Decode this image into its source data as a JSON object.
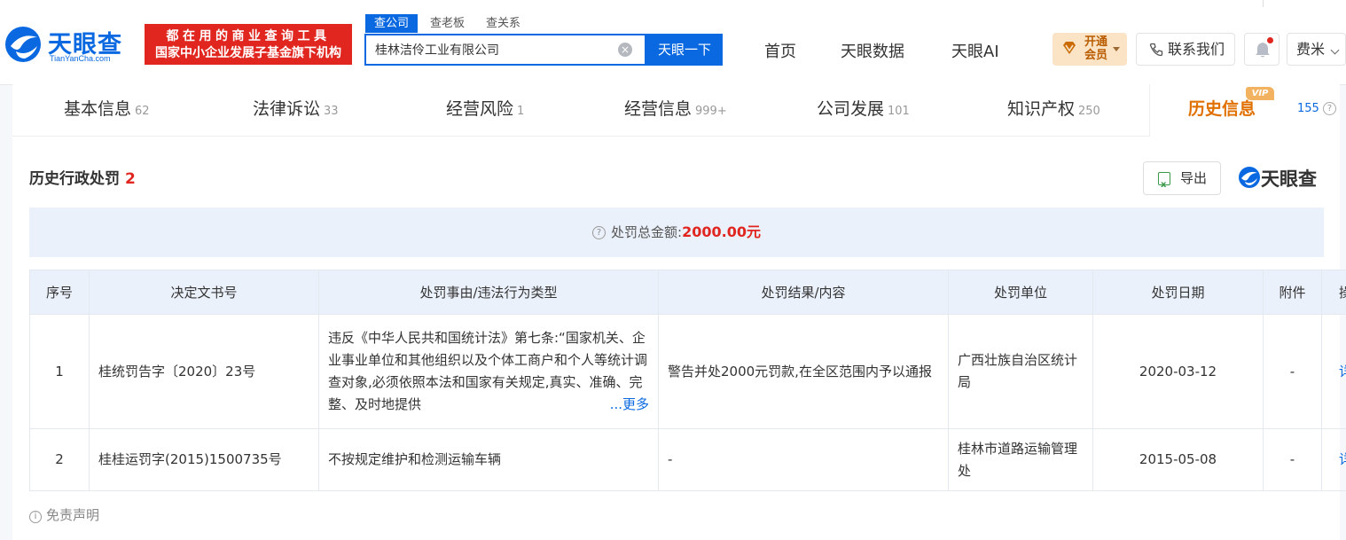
{
  "header": {
    "logo_text": "天眼查",
    "logo_sub": "TianYanCha.com",
    "promo_line1": "都在用的商业查询工具",
    "promo_line2": "国家中小企业发展子基金旗下机构",
    "search_tabs": [
      "查公司",
      "查老板",
      "查关系"
    ],
    "search_value": "桂林洁伶工业有限公司",
    "search_button": "天眼一下",
    "nav": [
      "首页",
      "天眼数据",
      "天眼AI"
    ],
    "vip_label": "开通会员",
    "contact_label": "联系我们",
    "user_name": "费米"
  },
  "tabs": [
    {
      "label": "基本信息",
      "count": "62"
    },
    {
      "label": "法律诉讼",
      "count": "33"
    },
    {
      "label": "经营风险",
      "count": "1"
    },
    {
      "label": "经营信息",
      "count": "999+"
    },
    {
      "label": "公司发展",
      "count": "101"
    },
    {
      "label": "知识产权",
      "count": "250"
    }
  ],
  "active_tab": {
    "label": "历史信息",
    "count": "155",
    "badge": "VIP"
  },
  "section": {
    "title": "历史行政处罚",
    "count": "2",
    "export_label": "导出",
    "brand": "天眼查",
    "summary_label": "处罚总金额:",
    "summary_amount": "2000.00元"
  },
  "table": {
    "headers": [
      "序号",
      "决定文书号",
      "处罚事由/违法行为类型",
      "处罚结果/内容",
      "处罚单位",
      "处罚日期",
      "附件",
      "操作"
    ],
    "rows": [
      {
        "index": "1",
        "doc_no": "桂统罚告字〔2020〕23号",
        "reason": "违反《中华人民共和国统计法》第七条:“国家机关、企业事业单位和其他组织以及个体工商户和个人等统计调查对象,必须依照本法和国家有关规定,真实、准确、完整、及时地提供",
        "more": "...更多",
        "result": "警告并处2000元罚款,在全区范围内予以通报",
        "unit": "广西壮族自治区统计局",
        "date": "2020-03-12",
        "attachment": "-",
        "action": "详情"
      },
      {
        "index": "2",
        "doc_no": "桂桂运罚字(2015)1500735号",
        "reason": "不按规定维护和检测运输车辆",
        "more": "",
        "result": "-",
        "unit": "桂林市道路运输管理处",
        "date": "2015-05-08",
        "attachment": "-",
        "action": "详情"
      }
    ]
  },
  "disclaimer": "免责声明",
  "colors": {
    "brand_blue": "#0a69e1",
    "alert_red": "#e0261f",
    "vip_orange": "#e07000"
  }
}
